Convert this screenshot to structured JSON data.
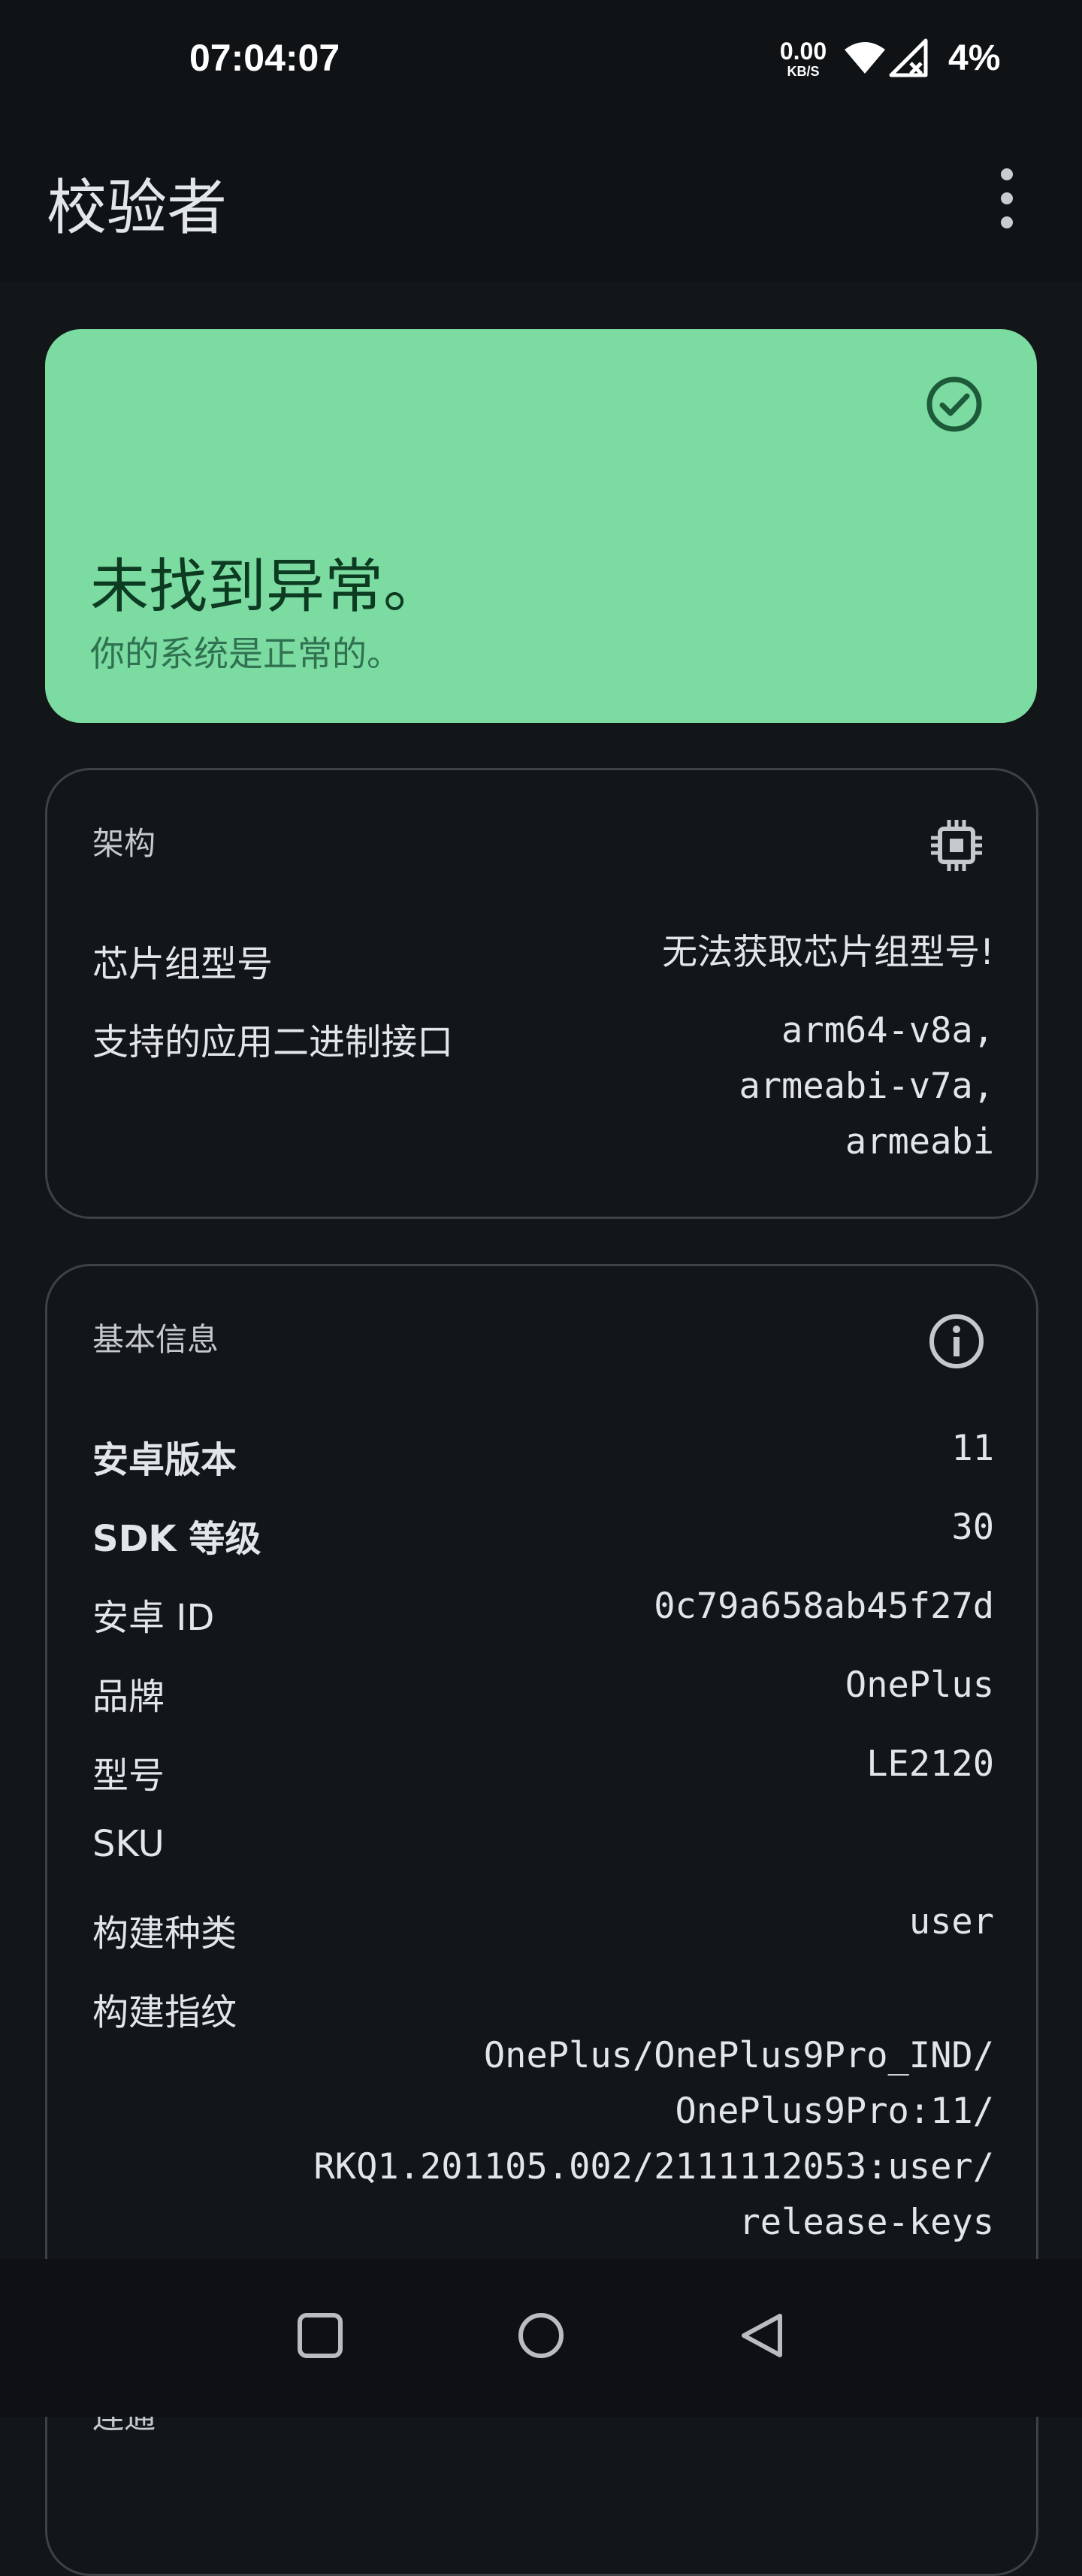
{
  "status_bar": {
    "time": "07:04:07",
    "net_speed_value": "0.00",
    "net_speed_unit": "KB/S",
    "battery": "4%"
  },
  "app_bar": {
    "title": "校验者"
  },
  "status_card": {
    "title": "未找到异常。",
    "subtitle": "你的系统是正常的。",
    "color": "#7bdba1"
  },
  "architecture": {
    "title": "架构",
    "rows": [
      {
        "label": "芯片组型号",
        "value": "无法获取芯片组型号!"
      },
      {
        "label": "支持的应用二进制接口",
        "value": "arm64-v8a,\narmeabi-v7a,\narmeabi"
      }
    ]
  },
  "basic_info": {
    "title": "基本信息",
    "rows": [
      {
        "label": "安卓版本",
        "value": "11"
      },
      {
        "label": "SDK 等级",
        "value": "30"
      },
      {
        "label": "安卓 ID",
        "value": "0c79a658ab45f27d"
      },
      {
        "label": "品牌",
        "value": "OnePlus"
      },
      {
        "label": "型号",
        "value": "LE2120"
      },
      {
        "label": "SKU",
        "value": ""
      },
      {
        "label": "构建种类",
        "value": "user"
      },
      {
        "label": "构建指纹",
        "value": "OnePlus/OnePlus9Pro_IND/\nOnePlus9Pro:11/\nRKQ1.201105.002/2111112053:user/\nrelease-keys"
      }
    ]
  },
  "root_card": {
    "title": "连通"
  },
  "icons": {
    "status_check": "check-circle-icon",
    "architecture": "chip-icon",
    "basic_info": "info-icon",
    "nav_recents": "square-icon",
    "nav_home": "circle-icon",
    "nav_back": "triangle-back-icon"
  }
}
